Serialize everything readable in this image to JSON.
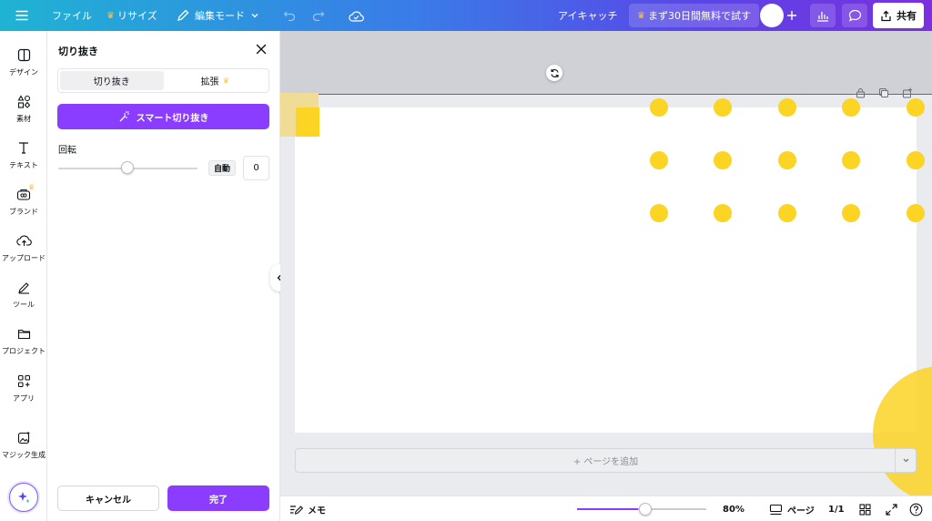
{
  "topbar": {
    "menu_icon": "hamburger-icon",
    "file_label": "ファイル",
    "resize_label": "リサイズ",
    "edit_mode_label": "編集モード",
    "design_title": "アイキャッチ",
    "trial_label": "まず30日間無料で試す",
    "share_label": "共有"
  },
  "rail": {
    "items": [
      {
        "label": "デザイン",
        "icon": "layout-icon"
      },
      {
        "label": "素材",
        "icon": "shapes-icon"
      },
      {
        "label": "テキスト",
        "icon": "text-icon"
      },
      {
        "label": "ブランド",
        "icon": "brand-icon"
      },
      {
        "label": "アップロード",
        "icon": "cloud-upload-icon"
      },
      {
        "label": "ツール",
        "icon": "pen-tool-icon"
      },
      {
        "label": "プロジェクト",
        "icon": "folder-icon"
      },
      {
        "label": "アプリ",
        "icon": "apps-icon"
      },
      {
        "label": "マジック生成",
        "icon": "magic-image-icon"
      }
    ]
  },
  "panel": {
    "title": "切り抜き",
    "tabs": [
      {
        "label": "切り抜き",
        "active": true
      },
      {
        "label": "拡張",
        "active": false
      }
    ],
    "smart_crop_label": "スマート切り抜き",
    "rotation_label": "回転",
    "rotation_progress": 0.5,
    "auto_label": "自動",
    "rotation_value": "0",
    "cancel_label": "キャンセル",
    "done_label": "完了"
  },
  "canvas": {
    "add_page_label": "+ ページを追加",
    "accent_color": "#8b3dff",
    "yellow_color": "#fbd424"
  },
  "bottombar": {
    "notes_label": "メモ",
    "zoom_value": 80,
    "zoom_label": "80%",
    "page_label": "ページ",
    "page_count": "1/1"
  }
}
